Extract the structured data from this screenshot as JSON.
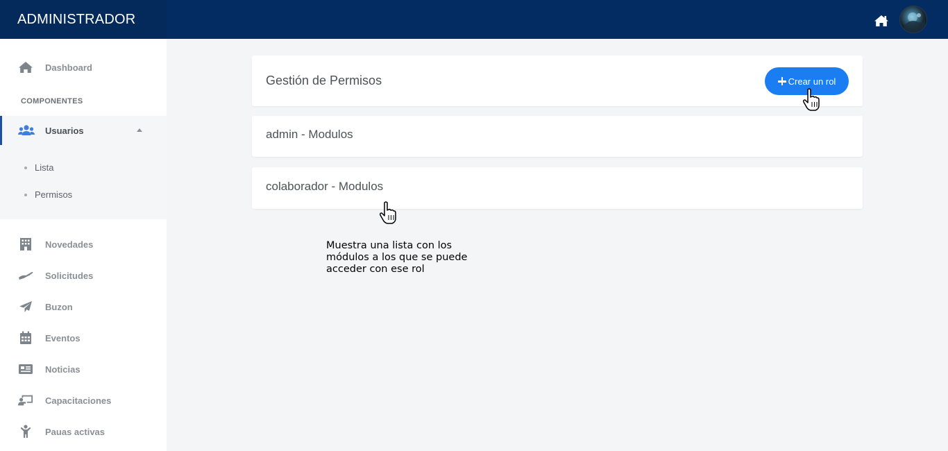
{
  "header": {
    "brand": "ADMINISTRADOR",
    "home_icon": "home-icon",
    "avatar": "user-avatar"
  },
  "sidebar": {
    "dashboard": {
      "label": "Dashboard",
      "icon": "home-icon"
    },
    "section_title": "COMPONENTES",
    "usuarios": {
      "label": "Usuarios",
      "icon": "users-icon",
      "expanded": true,
      "sub_items": [
        {
          "label": "Lista"
        },
        {
          "label": "Permisos"
        }
      ]
    },
    "items": [
      {
        "label": "Novedades",
        "icon": "building-icon"
      },
      {
        "label": "Solicitudes",
        "icon": "hand-icon"
      },
      {
        "label": "Buzon",
        "icon": "paper-plane-icon"
      },
      {
        "label": "Eventos",
        "icon": "calendar-icon"
      },
      {
        "label": "Noticias",
        "icon": "newspaper-icon"
      },
      {
        "label": "Capacitaciones",
        "icon": "chalkboard-teacher-icon"
      },
      {
        "label": "Pauas activas",
        "icon": "child-icon"
      }
    ]
  },
  "main": {
    "title": "Gestión de Permisos",
    "create_button": "Crear un rol",
    "roles": [
      {
        "title": "admin - Modulos"
      },
      {
        "title": "colaborador - Modulos"
      }
    ],
    "annotation": "Muestra una lista con los módulos a los que se puede acceder con ese rol"
  },
  "colors": {
    "topbar": "#032c63",
    "accent": "#1a7ef2",
    "active_indicator": "#1f4fa0"
  }
}
